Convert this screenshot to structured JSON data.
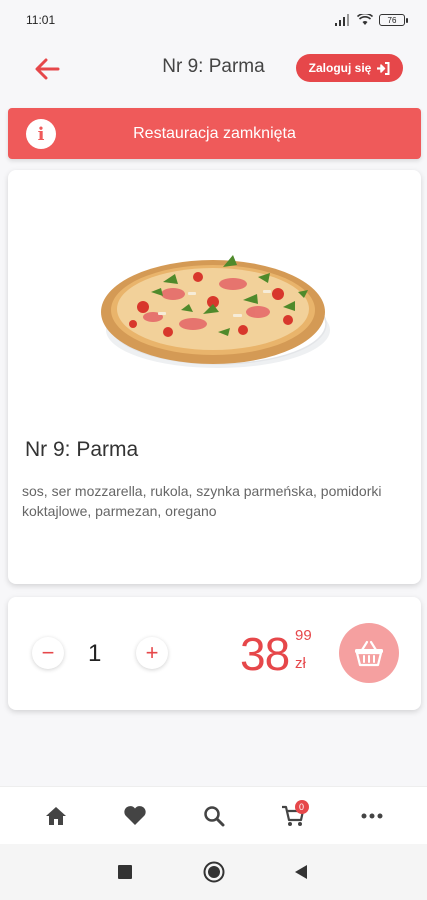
{
  "status_bar": {
    "time": "11:01",
    "battery": "76"
  },
  "header": {
    "title": "Nr 9: Parma",
    "login_label": "Zaloguj się"
  },
  "banner": {
    "text": "Restauracja zamknięta",
    "icon_glyph": "i"
  },
  "product": {
    "name": "Nr 9: Parma",
    "description": "sos, ser mozzarella, rukola, szynka parmeńska, pomidorki koktajlowe, parmezan, oregano"
  },
  "order": {
    "minus_glyph": "−",
    "plus_glyph": "+",
    "quantity": "1",
    "price_main": "38",
    "price_cents": "99",
    "currency": "zł"
  },
  "bottom_nav": {
    "cart_badge": "0",
    "icons": [
      "home-icon",
      "heart-icon",
      "search-icon",
      "cart-icon",
      "more-icon"
    ]
  },
  "colors": {
    "accent": "#e6474a",
    "banner": "#ef5a5a",
    "cart_button": "#f5a0a0"
  }
}
